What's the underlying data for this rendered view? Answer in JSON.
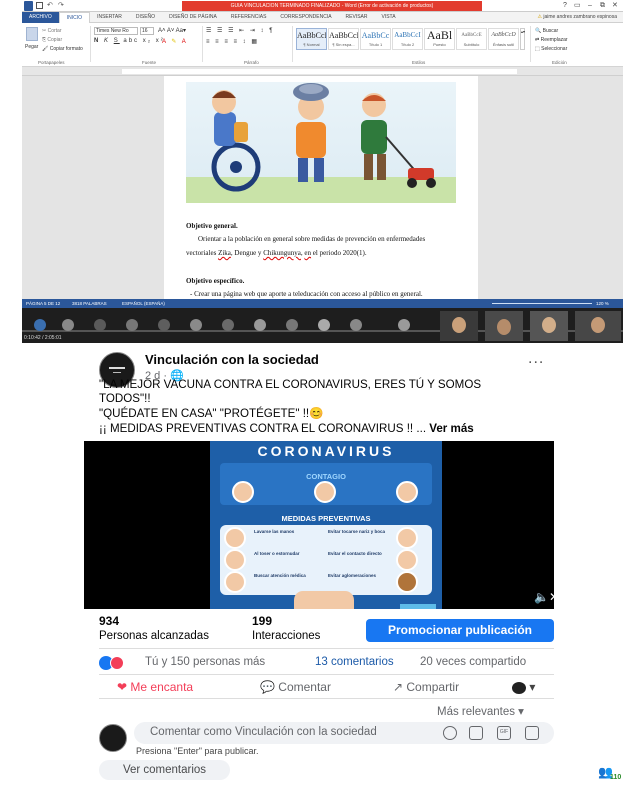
{
  "word": {
    "title_bar": "GUIA VINCULACION TERMINADO FINALIZADO - Word (Error de activación de productos)",
    "window_controls": [
      "?",
      "▭",
      "–",
      "⧉",
      "✕"
    ],
    "tabs": [
      "ARCHIVO",
      "INICIO",
      "INSERTAR",
      "DISEÑO",
      "DISEÑO DE PÁGINA",
      "REFERENCIAS",
      "CORRESPONDENCIA",
      "REVISAR",
      "VISTA"
    ],
    "account": "jaime andres zambrano espinosa",
    "clipboard": {
      "paste": "Pegar",
      "cut": "Cortar",
      "copy": "Copiar",
      "format": "Copiar formato",
      "group": "Portapapeles"
    },
    "font": {
      "name": "Times New Ro",
      "size": "16",
      "group": "Fuente"
    },
    "paragraph_group": "Párrafo",
    "styles": [
      {
        "sample": "AaBbCcI",
        "name": "¶ Normal"
      },
      {
        "sample": "AaBbCcI",
        "name": "¶ Sin espa..."
      },
      {
        "sample": "AaBbCc",
        "name": "Título 1"
      },
      {
        "sample": "AaBbCcI",
        "name": "Título 2"
      },
      {
        "sample": "AaBl",
        "name": "Puesto"
      },
      {
        "sample": "AaBbCcE",
        "name": "Subtítulo"
      },
      {
        "sample": "AaBbCcD",
        "name": "Énfasis sutil"
      }
    ],
    "styles_group": "Estilos",
    "editing": {
      "find": "Buscar",
      "replace": "Reemplazar",
      "select": "Seleccionar",
      "group": "Edición"
    },
    "doc": {
      "heading1": "Objetivo general.",
      "para1_line1": "Orientar a la población en general sobre medidas de prevención en enfermedades",
      "para1_pre": "vectoriales ",
      "para1_zika": "Zika",
      "para1_mid": ", Dengue y ",
      "para1_chik": "Chikungunya",
      "para1_comma": ", ",
      "para1_en": "en",
      "para1_post": " el periodo 2020(1).",
      "heading2": "Objetivo específico.",
      "bullet1": "-   Crear una página web que aporte a teleducación con acceso al público en general."
    },
    "status": {
      "page": "PÁGINA 5 DE 12",
      "words": "3818 PALABRAS",
      "lang": "ESPAÑOL (ESPAÑA)",
      "zoom": "120 %"
    },
    "taskbar_time": "0:10:42 / 2:05:01"
  },
  "post": {
    "page_name": "Vinculación con la sociedad",
    "meta": "2 d · ",
    "more": "...",
    "line1": "\"LA MEJOR VACUNA CONTRA EL CORONAVIRUS, ERES TÚ Y SOMOS",
    "line2": "TODOS\"!!",
    "line3": "\"QUÉDATE EN CASA\" \"PROTÉGETE\" !!😊",
    "line4": "¡¡ MEDIDAS PREVENTIVAS CONTRA EL CORONAVIRUS !! ... ",
    "see_more": "Ver más",
    "infographic": {
      "title": "CORONAVIRUS",
      "section1": "CONTAGIO",
      "section2": "MEDIDAS PREVENTIVAS",
      "tips": [
        "Lavarse las manos",
        "Evitar tocarse nariz y boca",
        "Al toser o estornudar",
        "Evitar el contacto directo",
        "Buscar atención médica",
        "Evitar aglomeraciones"
      ]
    },
    "reach_num": "934",
    "reach_label": "Personas alcanzadas",
    "interactions_num": "199",
    "interactions_label": "Interacciones",
    "promote": "Promocionar publicación",
    "reactions_text": "Tú y 150 personas más",
    "comments_count": "13 comentarios",
    "shares": "20 veces compartido",
    "like": "Me encanta",
    "comment": "Comentar",
    "share": "Compartir",
    "sort": "Más relevantes",
    "comment_placeholder": "Comentar como Vinculación con la sociedad",
    "enter_hint": "Presiona \"Enter\" para publicar.",
    "view_comments": "Ver comentarios",
    "badge_count": "110"
  },
  "colors": {
    "word_blue": "#2b579a",
    "fb_blue": "#1877f2",
    "love_red": "#f33e58",
    "activation_red": "#e23b2e"
  }
}
